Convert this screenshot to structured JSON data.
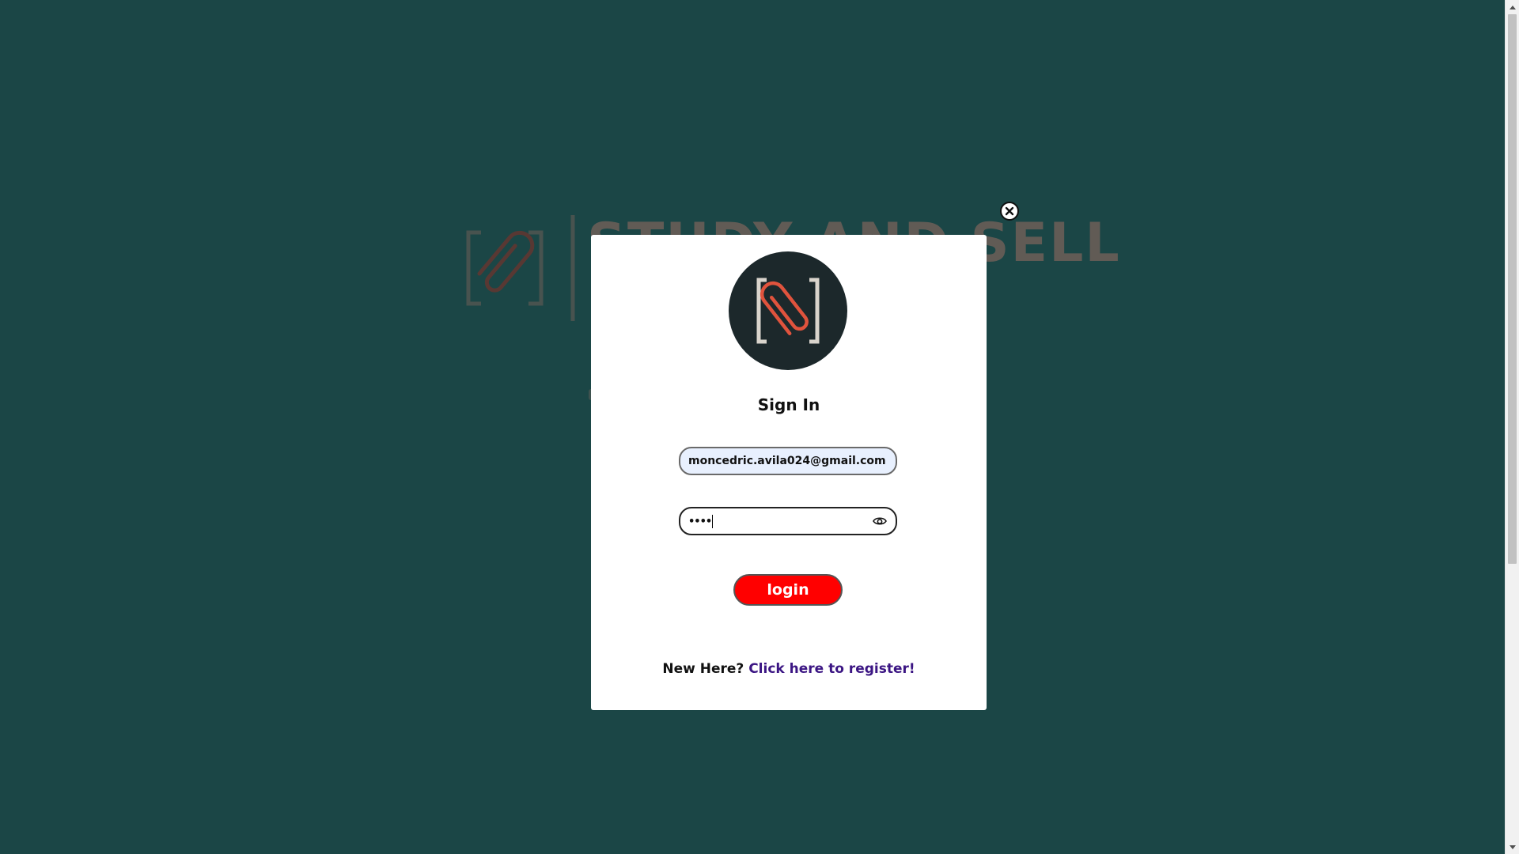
{
  "background": {
    "brand_name": "STUDY AND SELL",
    "brand_tagline": "C E"
  },
  "modal": {
    "title": "Sign In",
    "email_value": "moncedric.avila024@gmail.com",
    "password_value": "••••",
    "login_label": "login",
    "register_prompt": "New Here?",
    "register_link": "Click here to register!"
  },
  "icons": {
    "close": "close-circle-icon",
    "eye": "eye-icon",
    "logo": "paperclip-brackets-logo"
  },
  "colors": {
    "page_background": "#1b4646",
    "login_button": "#ff0000",
    "register_link": "#3b1583",
    "avatar_background": "#1c282b",
    "logo_clip": "#e0533d",
    "logo_brackets": "#d9d4cc"
  }
}
